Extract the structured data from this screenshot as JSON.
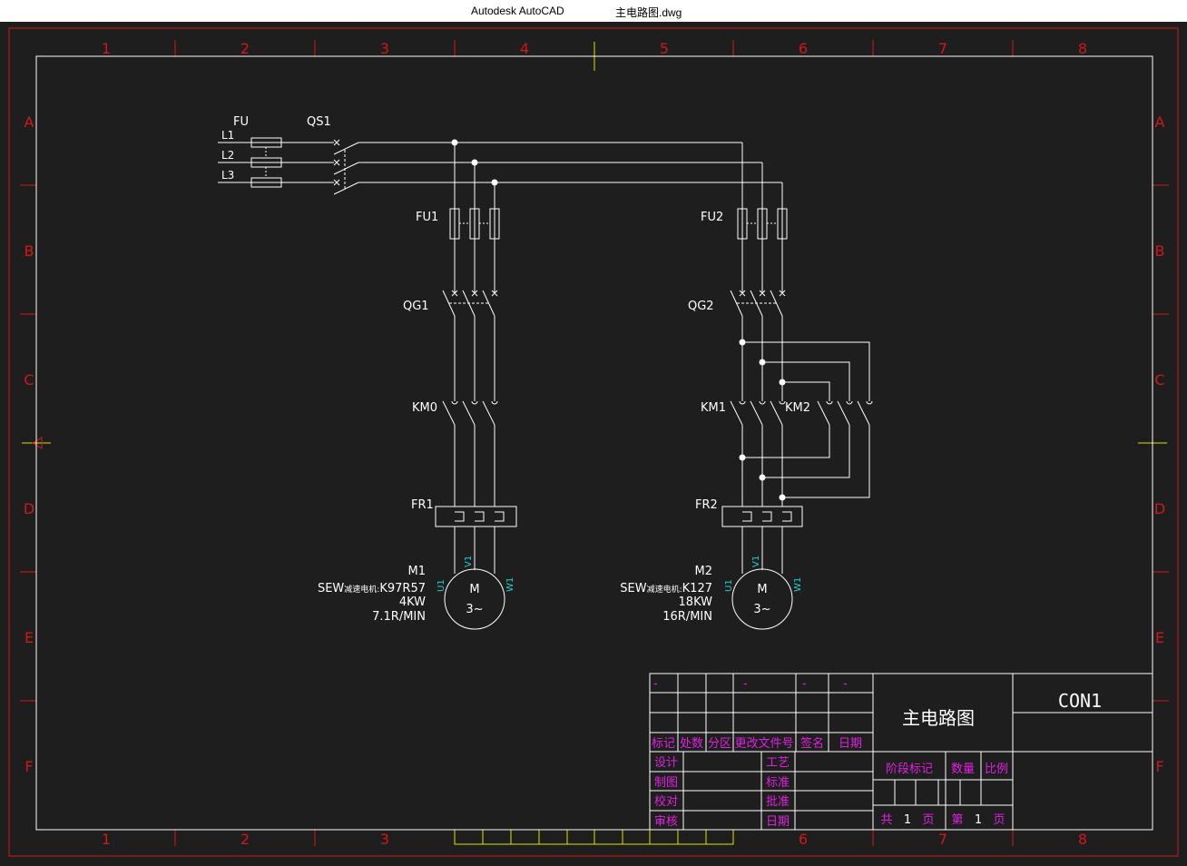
{
  "window": {
    "app_name": "Autodesk AutoCAD",
    "file_name": "主电路图.dwg"
  },
  "frame": {
    "col_labels": [
      "1",
      "2",
      "3",
      "4",
      "5",
      "6",
      "7",
      "8"
    ],
    "row_labels": [
      "A",
      "B",
      "C",
      "D",
      "E",
      "F"
    ]
  },
  "supply": {
    "fu_label": "FU",
    "qs_label": "QS1",
    "phases": [
      "L1",
      "L2",
      "L3"
    ]
  },
  "motor1": {
    "fuse": "FU1",
    "breaker": "QG1",
    "contactor": "KM0",
    "relay": "FR1",
    "name": "M1",
    "model_prefix": "SEW",
    "model_mid": "减速电机:",
    "model_suffix": "K97R57",
    "power": "4KW",
    "speed": "7.1R/MIN",
    "symbol_top": "M",
    "symbol_bottom": "3~",
    "terminals": [
      "U1",
      "V1",
      "W1"
    ]
  },
  "motor2": {
    "fuse": "FU2",
    "breaker": "QG2",
    "contactor_a": "KM1",
    "contactor_b": "KM2",
    "relay": "FR2",
    "name": "M2",
    "model_prefix": "SEW",
    "model_mid": "减速电机:",
    "model_suffix": "K127",
    "power": "18KW",
    "speed": "16R/MIN",
    "symbol_top": "M",
    "symbol_bottom": "3~",
    "terminals": [
      "U1",
      "V1",
      "W1"
    ]
  },
  "title_block": {
    "rev_dashes": [
      "-",
      "-",
      "-",
      "-",
      "-"
    ],
    "rev_headers": [
      "标记",
      "处数",
      "分区",
      "更改文件号",
      "签名",
      "日期"
    ],
    "left_roles": [
      "设计",
      "制图",
      "校对",
      "审核"
    ],
    "mid_roles": [
      "工艺",
      "标准",
      "批准",
      "日期"
    ],
    "drawing_title": "主电路图",
    "drawing_code": "CON1",
    "stage_headers": [
      "阶段标记",
      "数量",
      "比例"
    ],
    "sheet_total_prefix": "共",
    "sheet_total": "1",
    "sheet_total_suffix": "页",
    "sheet_num_prefix": "第",
    "sheet_num": "1",
    "sheet_num_suffix": "页"
  },
  "colors": {
    "background": "#1e1e1e",
    "frame_red": "#d01818",
    "lines": "#ffffff",
    "magenta": "#e020e0",
    "cyan": "#20d0d0",
    "yellow": "#e0e000"
  }
}
